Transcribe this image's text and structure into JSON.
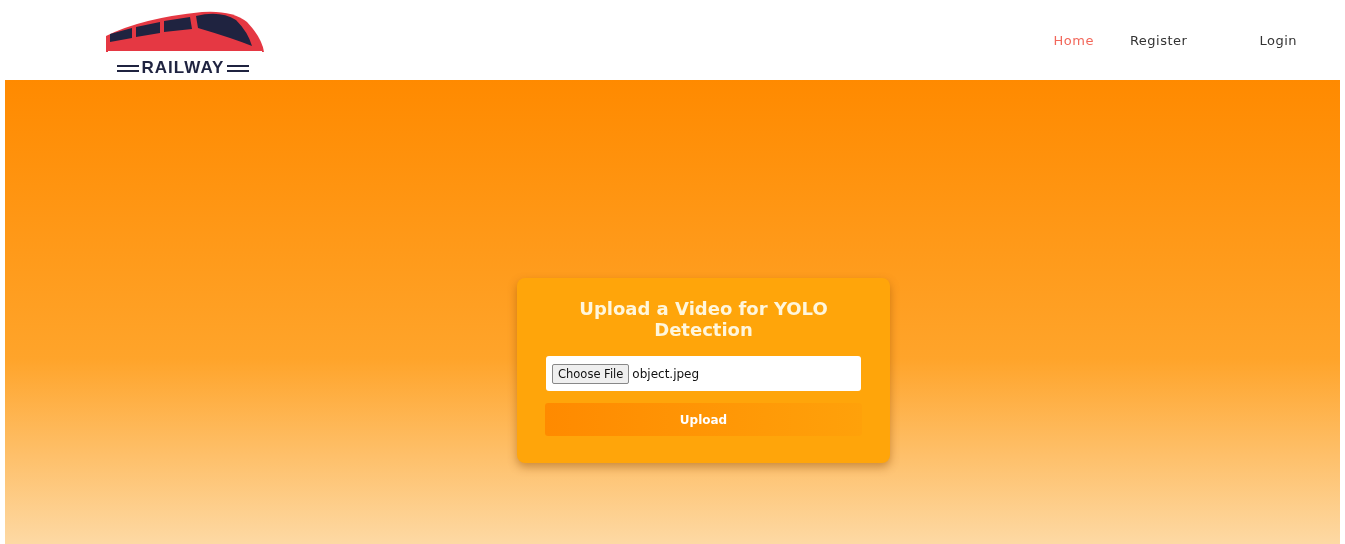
{
  "header": {
    "logo_text": "RAILWAY",
    "nav": [
      {
        "label": "Home",
        "selected": true
      },
      {
        "label": "Register",
        "selected": false
      },
      {
        "label": "Login",
        "selected": false
      }
    ]
  },
  "upload_card": {
    "title": "Upload a Video for YOLO Detection",
    "file_button": "Choose File",
    "file_name": "object.jpeg",
    "submit": "Upload"
  }
}
